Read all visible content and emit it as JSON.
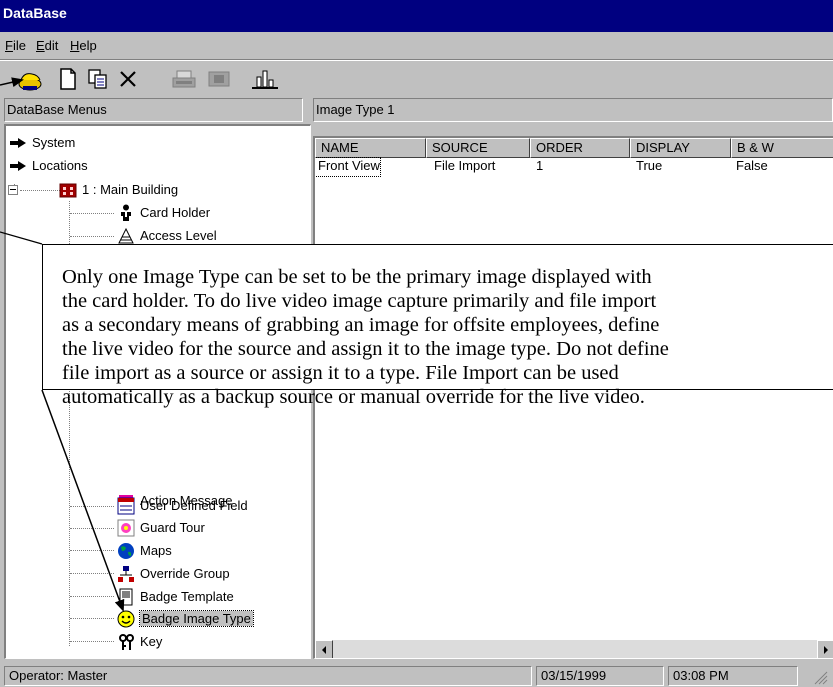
{
  "window": {
    "title": "DataBase"
  },
  "menu": [
    {
      "label": "File"
    },
    {
      "label": "Edit"
    },
    {
      "label": "Help"
    }
  ],
  "toolbar": {
    "buttons": [
      {
        "icon": "hand-icon"
      },
      {
        "icon": "new-document-icon"
      },
      {
        "icon": "copy-icon"
      },
      {
        "icon": "delete-icon"
      },
      {
        "icon": "print-icon"
      },
      {
        "icon": "preview-icon"
      },
      {
        "icon": "chart-icon"
      }
    ]
  },
  "left_pane": {
    "header": "DataBase Menus",
    "tree": [
      {
        "label": "System",
        "icon": "arrow-icon"
      },
      {
        "label": "Locations",
        "icon": "arrow-icon"
      },
      {
        "label": "1 : Main Building",
        "icon": "building-icon",
        "expander": "⊟"
      },
      {
        "label": "Card Holder",
        "icon": "person-icon"
      },
      {
        "label": "Access Level",
        "icon": "access-level-icon"
      },
      {
        "label": "Action Message",
        "icon": "action-message-icon"
      },
      {
        "label": "User Defined Field",
        "icon": "user-defined-field-icon"
      },
      {
        "label": "Guard Tour",
        "icon": "guard-tour-icon"
      },
      {
        "label": "Maps",
        "icon": "globe-icon"
      },
      {
        "label": "Override Group",
        "icon": "override-group-icon"
      },
      {
        "label": "Badge Template",
        "icon": "badge-template-icon"
      },
      {
        "label": "Badge Image Type",
        "icon": "smiley-icon",
        "selected": true
      },
      {
        "label": "Key",
        "icon": "key-icon"
      }
    ]
  },
  "right_pane": {
    "header": "Image Type  1",
    "columns": [
      "NAME",
      "SOURCE",
      "ORDER",
      "DISPLAY",
      "B & W"
    ],
    "rows": [
      [
        "Front View",
        "File Import",
        "1",
        "True",
        "False"
      ]
    ]
  },
  "callout": {
    "lines": [
      "Only one Image Type can be set to be the primary image displayed with",
      "the card holder. To do live video image capture primarily and file import",
      "as a secondary means of grabbing an image for offsite employees, define",
      "the live video for the source and assign it to the image type. Do not define",
      "file import as a source or assign it to a type. File Import can be used",
      "automatically as a backup source or manual override for the live video."
    ]
  },
  "statusbar": {
    "operator": "Operator: Master",
    "date": "03/15/1999",
    "time": "03:08 PM"
  },
  "colors": {
    "titlebar": "#000080",
    "face": "#c0c0c0",
    "selection": "#000080"
  }
}
